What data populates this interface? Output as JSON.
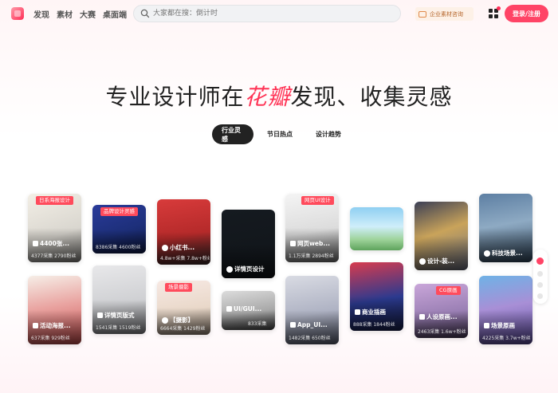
{
  "nav": [
    "发现",
    "素材",
    "大赛",
    "桌面端"
  ],
  "search": {
    "placeholder": "大家都在搜：倒计时"
  },
  "enterprise_button": "企业素材咨询",
  "login_button": "登录/注册",
  "headline": {
    "before": "专业设计师在",
    "accent": "花瓣",
    "after": "发现、收集灵感"
  },
  "tabs": [
    "行业灵感",
    "节日热点",
    "设计趋势"
  ],
  "active_tab": "行业灵感",
  "cards": [
    {
      "tag": "日系海报设计",
      "title": "4400张...",
      "meta": "4377采集 2790粉丝",
      "icon": "board-icon"
    },
    {
      "tag": "",
      "title": "活动海报...",
      "meta": "637采集 929粉丝",
      "icon": "board-icon"
    },
    {
      "tag": "品牌设计灵感",
      "title": "",
      "meta": "8386采集 4600粉丝",
      "icon": "board-icon"
    },
    {
      "tag": "",
      "title": "详情页版式",
      "meta": "1541采集 1519粉丝",
      "icon": "board-icon"
    },
    {
      "tag": "",
      "title": "小红书...",
      "meta": "4.8w+采集 7.8w+粉丝",
      "icon": "circle-icon"
    },
    {
      "tag": "场景摄影",
      "title": "【摄影】",
      "meta": "6664采集 1429粉丝",
      "icon": "circle-icon"
    },
    {
      "tag": "",
      "title": "详情页设计",
      "meta": "",
      "icon": "circle-icon"
    },
    {
      "tag": "",
      "title": "UI/GUI...",
      "meta": "833采集",
      "icon": "board-icon"
    },
    {
      "tag": "网页UI设计",
      "title": "网页web...",
      "meta": "1.1万采集 2894粉丝",
      "icon": "board-icon"
    },
    {
      "tag": "",
      "title": "App_UI...",
      "meta": "1482采集 650粉丝",
      "icon": "board-icon"
    },
    {
      "tag": "",
      "title": "",
      "meta": "",
      "icon": ""
    },
    {
      "tag": "",
      "title": "商业插画",
      "meta": "888采集 1844粉丝",
      "icon": "board-icon"
    },
    {
      "tag": "",
      "title": "设计-装...",
      "meta": "",
      "icon": "circle-icon"
    },
    {
      "tag": "CG原画",
      "title": "人设原画...",
      "meta": "2463采集 1.6w+粉丝",
      "icon": "board-icon"
    },
    {
      "tag": "",
      "title": "科技场景...",
      "meta": "",
      "icon": "circle-icon"
    },
    {
      "tag": "",
      "title": "场景原画",
      "meta": "4225采集 3.7w+粉丝",
      "icon": "board-icon"
    }
  ],
  "colors": {
    "brand": "#ff4466",
    "accent_text": "#ff3355",
    "enterprise_bg": "#fdf1e7"
  }
}
